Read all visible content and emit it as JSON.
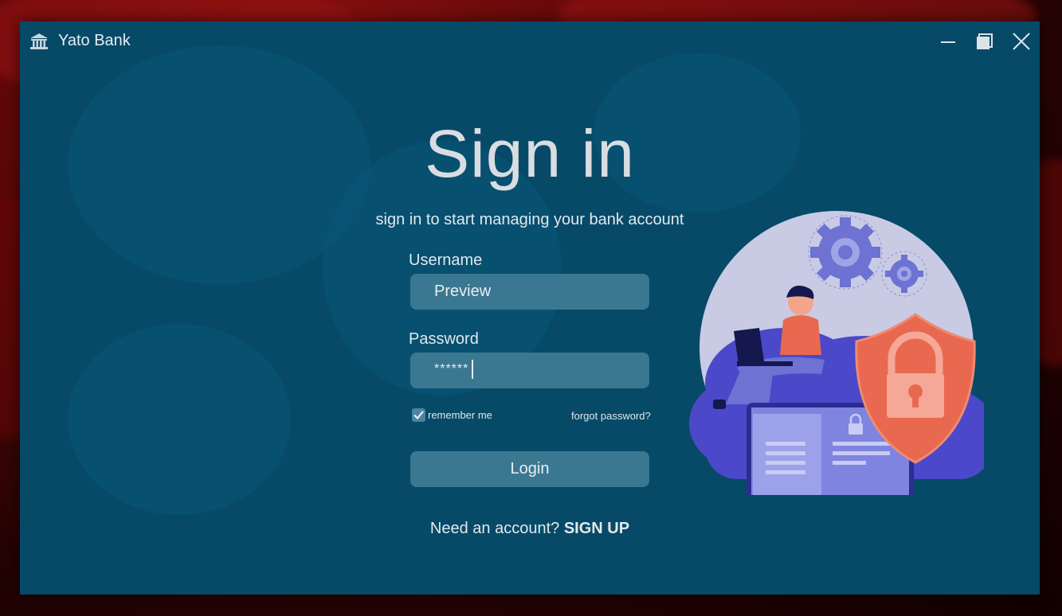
{
  "window": {
    "title": "Yato Bank",
    "icon": "bank-icon"
  },
  "controls": {
    "minimize_icon": "minimize-icon",
    "maximize_icon": "maximize-icon",
    "close_icon": "close-icon"
  },
  "form": {
    "heading": "Sign in",
    "subheading": "sign in to start managing your bank account",
    "username_label": "Username",
    "username_value": "Preview",
    "password_label": "Password",
    "password_value": "******",
    "remember_label": "remember me",
    "remember_checked": true,
    "forgot_label": "forgot password?",
    "login_label": "Login",
    "signup_prompt": "Need an account?",
    "signup_link": "SIGN UP"
  },
  "illustration": {
    "icon": "security-illustration",
    "elements": [
      "person-with-laptop",
      "gear-icon",
      "shield-lock-icon",
      "monitor-icon"
    ]
  },
  "colors": {
    "window_bg": "#064a68",
    "field_bg": "#3a7892",
    "text": "#e3e8ec",
    "shield": "#e8694f",
    "cloud": "#4b49c9"
  }
}
